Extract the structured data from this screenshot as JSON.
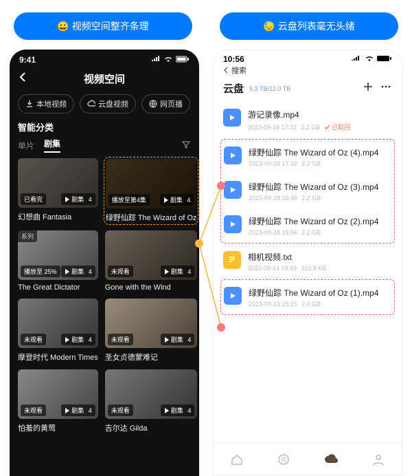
{
  "banners": {
    "left_emoji": "😀",
    "left_text": "视频空间整齐条理",
    "right_emoji": "😓",
    "right_text": "云盘列表毫无头绪"
  },
  "left": {
    "time": "9:41",
    "header_title": "视频空间",
    "chips": {
      "local": "本地视频",
      "cloud": "云盘视频",
      "web": "网页播"
    },
    "section_title": "智能分类",
    "tabs": {
      "single": "单片",
      "series": "剧集"
    },
    "cards": [
      {
        "corner": "",
        "badge_left": "已看完",
        "badge_right": "剧集",
        "count": "4",
        "title": "幻想曲 Fantasia"
      },
      {
        "corner": "",
        "badge_left": "播放至第4集",
        "badge_right": "剧集",
        "count": "4",
        "title": "绿野仙踪 The Wizard of Oz"
      },
      {
        "corner": "系列",
        "badge_left": "播放至 25%",
        "badge_right": "剧集",
        "count": "4",
        "title": "The Great Dictator"
      },
      {
        "corner": "",
        "badge_left": "未观看",
        "badge_right": "剧集",
        "count": "4",
        "title": "Gone with the Wind"
      },
      {
        "corner": "",
        "badge_left": "未观看",
        "badge_right": "剧集",
        "count": "4",
        "title": "摩登时代 Modern Times"
      },
      {
        "corner": "",
        "badge_left": "未观看",
        "badge_right": "剧集",
        "count": "4",
        "title": "圣女贞德蒙难记"
      },
      {
        "corner": "",
        "badge_left": "未观看",
        "badge_right": "剧集",
        "count": "4",
        "title": "怕羞的黄莺"
      },
      {
        "corner": "",
        "badge_left": "未观看",
        "badge_right": "剧集",
        "count": "4",
        "title": "吉尔达 Gilda"
      }
    ]
  },
  "right": {
    "time": "10:56",
    "search_label": "搜索",
    "header_title": "云盘",
    "quota_used": "5.3 TB",
    "quota_total": "/12.0 TB",
    "files": [
      {
        "type": "video",
        "name": "游记录像.mp4",
        "date": "2023-09-18 17:32",
        "size": "2.2 GB",
        "recall": "已取回"
      },
      {
        "type": "video",
        "name": "绿野仙踪 The Wizard of Oz (4).mp4",
        "date": "2023-09-18 17:32",
        "size": "2.2 GB"
      },
      {
        "type": "video",
        "name": "绿野仙踪 The Wizard of Oz (3).mp4",
        "date": "2023-09-18 16:46",
        "size": "2.2 GB"
      },
      {
        "type": "video",
        "name": "绿野仙踪 The Wizard of Oz (2).mp4",
        "date": "2023-09-18 15:56",
        "size": "2.2 GB"
      },
      {
        "type": "txt",
        "name": "相机视频.txt",
        "date": "2023-09-14 19:49",
        "size": "310.8 KB"
      },
      {
        "type": "video",
        "name": "绿野仙踪 The Wizard of Oz (1).mp4",
        "date": "2023-09-13 15:15",
        "size": "2.0 GB"
      }
    ]
  }
}
